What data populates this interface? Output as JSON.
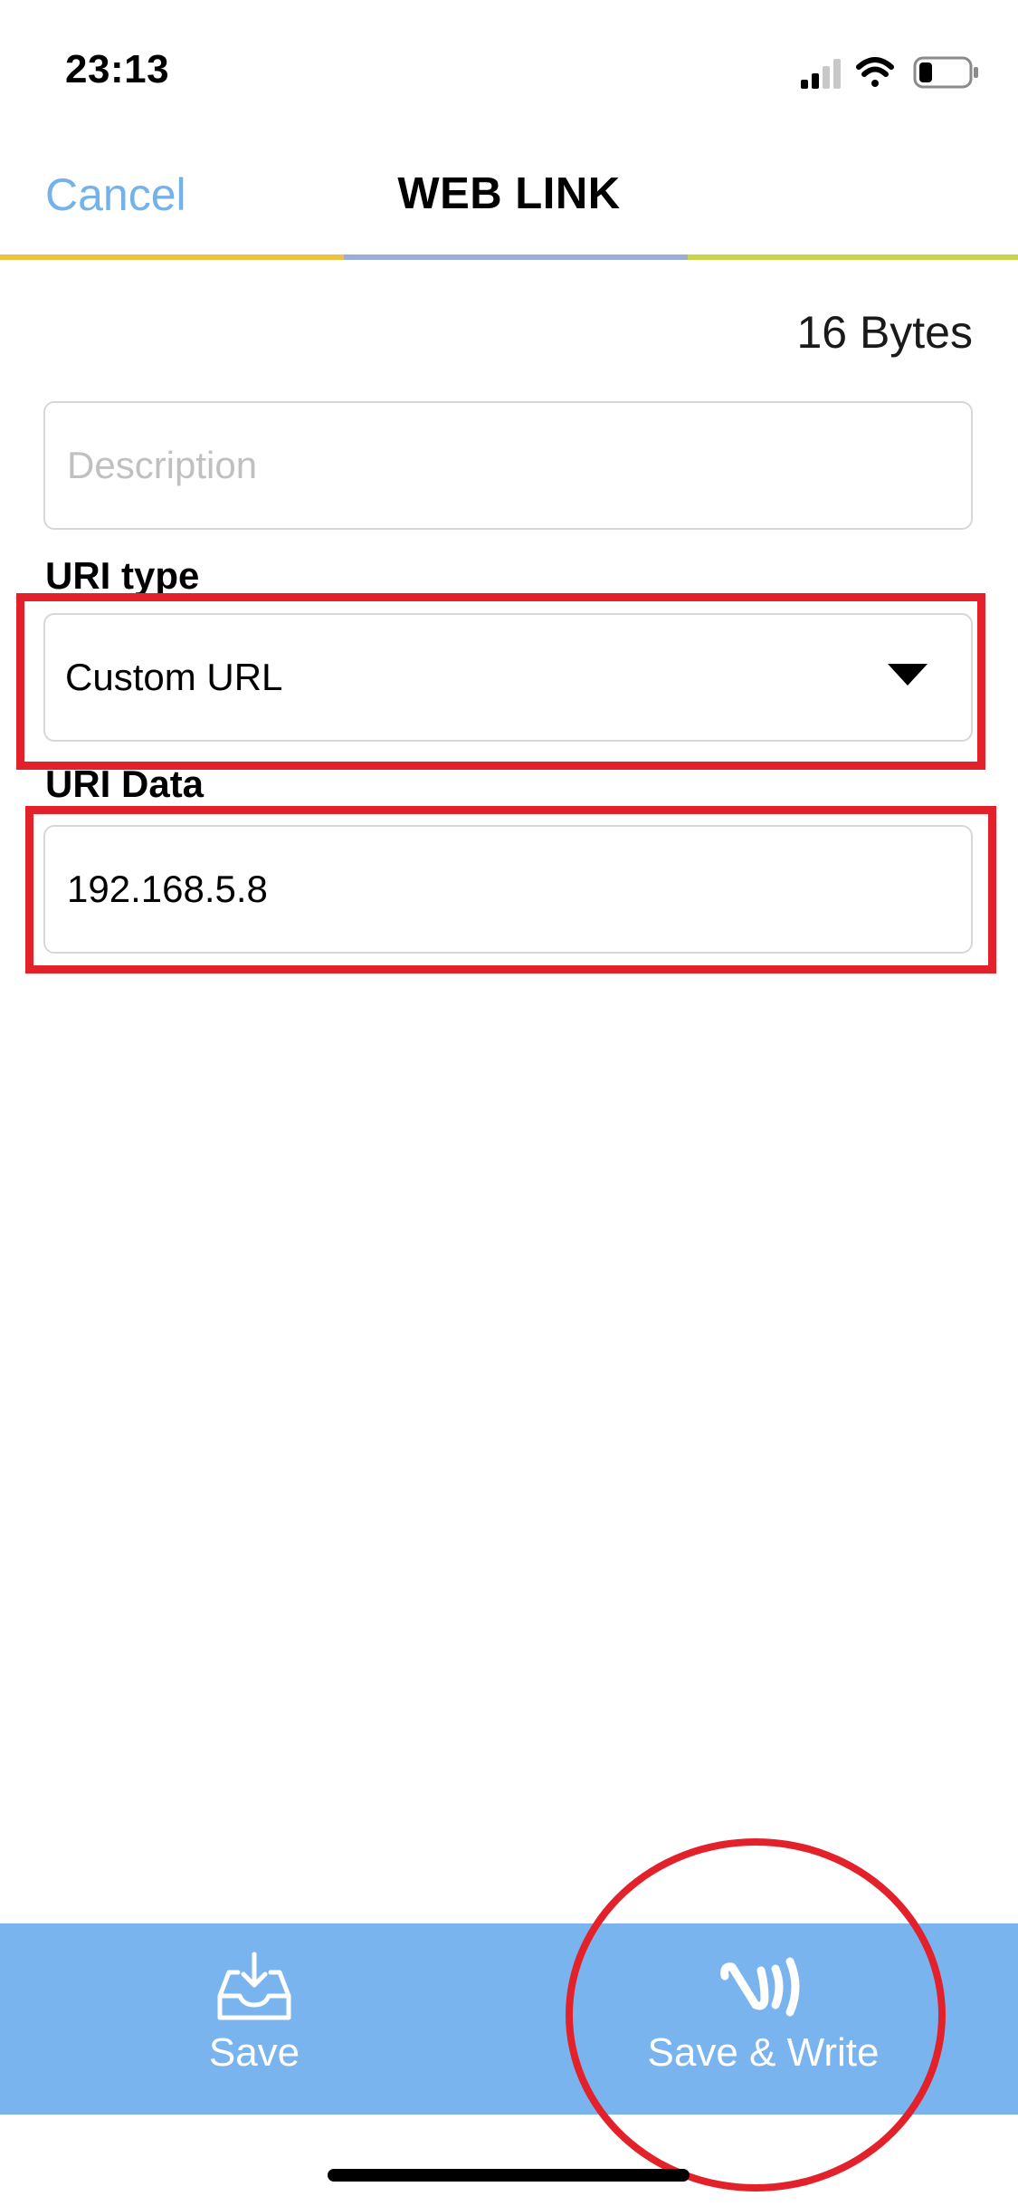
{
  "status_bar": {
    "time": "23:13",
    "icons": [
      "cellular-signal-icon",
      "wifi-icon",
      "battery-icon"
    ]
  },
  "nav": {
    "cancel_label": "Cancel",
    "title": "WEB LINK"
  },
  "byte_count": "16 Bytes",
  "description": {
    "placeholder": "Description",
    "value": ""
  },
  "uri_type": {
    "label": "URI type",
    "selected": "Custom URL"
  },
  "uri_data": {
    "label": "URI Data",
    "value": "192.168.5.8"
  },
  "bottom_bar": {
    "save_label": "Save",
    "save_write_label": "Save & Write"
  },
  "colors": {
    "accent": "#74b2ea",
    "bottom_bar": "#7ab4ee",
    "divider_yellow": "#f0c040",
    "divider_blue": "#9aaed6",
    "divider_green": "#c8d44a",
    "annotation_red": "#e3212b"
  }
}
